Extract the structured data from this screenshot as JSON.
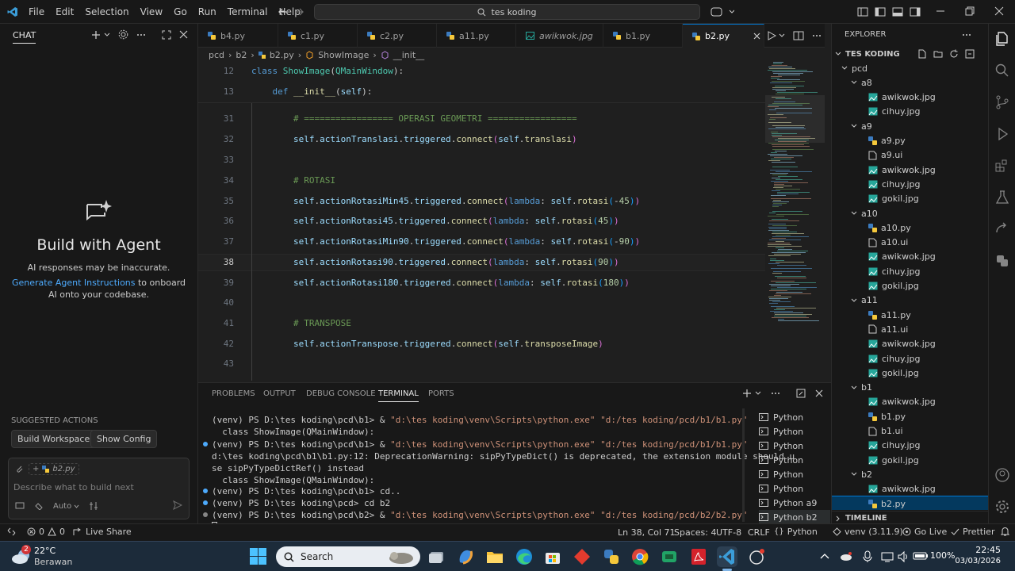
{
  "menu": [
    "File",
    "Edit",
    "Selection",
    "View",
    "Go",
    "Run",
    "Terminal",
    "Help"
  ],
  "search": {
    "text": "tes koding"
  },
  "chat": {
    "title": "CHAT",
    "headline": "Build with Agent",
    "disclaimer": "AI responses may be inaccurate.",
    "link": "Generate Agent Instructions",
    "link_rest": " to onboard AI onto your codebase.",
    "suggested_title": "SUGGESTED ACTIONS",
    "actions": [
      "Build Workspace",
      "Show Config"
    ],
    "attachment": "b2.py",
    "input_placeholder": "Describe what to build next",
    "mode": "Auto"
  },
  "tabs": [
    {
      "label": "b4.py",
      "icon": "python"
    },
    {
      "label": "c1.py",
      "icon": "python"
    },
    {
      "label": "c2.py",
      "icon": "python"
    },
    {
      "label": "a11.py",
      "icon": "python"
    },
    {
      "label": "awikwok.jpg",
      "icon": "image"
    },
    {
      "label": "b1.py",
      "icon": "python"
    },
    {
      "label": "b2.py",
      "icon": "python",
      "active": true
    }
  ],
  "breadcrumb": [
    "pcd",
    "b2",
    "b2.py",
    "ShowImage",
    "__init__"
  ],
  "code": {
    "sticky": [
      {
        "n": "12",
        "parts": [
          [
            "kw",
            "class "
          ],
          [
            "cls",
            "ShowImage"
          ],
          [
            "dt",
            "("
          ],
          [
            "cls",
            "QMainWindow"
          ],
          [
            "dt",
            "):"
          ]
        ]
      },
      {
        "n": "13",
        "parts": [
          [
            "dt",
            "    "
          ],
          [
            "kw",
            "def "
          ],
          [
            "fn",
            "__init__"
          ],
          [
            "dt",
            "("
          ],
          [
            "sf",
            "self"
          ],
          [
            "dt",
            "):"
          ]
        ]
      }
    ],
    "lines": [
      {
        "n": "30",
        "parts": []
      },
      {
        "n": "31",
        "parts": [
          [
            "dt",
            "        "
          ],
          [
            "cm",
            "# ================= OPERASI GEOMETRI ================="
          ]
        ]
      },
      {
        "n": "32",
        "parts": [
          [
            "dt",
            "        "
          ],
          [
            "sf",
            "self"
          ],
          [
            "dt",
            "."
          ],
          [
            "sf",
            "actionTranslasi"
          ],
          [
            "dt",
            "."
          ],
          [
            "sf",
            "triggered"
          ],
          [
            "dt",
            "."
          ],
          [
            "fn",
            "connect"
          ],
          [
            "pr",
            "("
          ],
          [
            "sf",
            "self"
          ],
          [
            "dt",
            "."
          ],
          [
            "fn",
            "translasi"
          ],
          [
            "pr",
            ")"
          ]
        ]
      },
      {
        "n": "33",
        "parts": []
      },
      {
        "n": "34",
        "parts": [
          [
            "dt",
            "        "
          ],
          [
            "cm",
            "# ROTASI"
          ]
        ]
      },
      {
        "n": "35",
        "parts": [
          [
            "dt",
            "        "
          ],
          [
            "sf",
            "self"
          ],
          [
            "dt",
            "."
          ],
          [
            "sf",
            "actionRotasiMin45"
          ],
          [
            "dt",
            "."
          ],
          [
            "sf",
            "triggered"
          ],
          [
            "dt",
            "."
          ],
          [
            "fn",
            "connect"
          ],
          [
            "pr",
            "("
          ],
          [
            "kw",
            "lambda"
          ],
          [
            "dt",
            ": "
          ],
          [
            "sf",
            "self"
          ],
          [
            "dt",
            "."
          ],
          [
            "fn",
            "rotasi"
          ],
          [
            "pb",
            "("
          ],
          [
            "dt",
            "-"
          ],
          [
            "nm",
            "45"
          ],
          [
            "pb",
            ")"
          ],
          [
            "pr",
            ")"
          ]
        ]
      },
      {
        "n": "36",
        "parts": [
          [
            "dt",
            "        "
          ],
          [
            "sf",
            "self"
          ],
          [
            "dt",
            "."
          ],
          [
            "sf",
            "actionRotasi45"
          ],
          [
            "dt",
            "."
          ],
          [
            "sf",
            "triggered"
          ],
          [
            "dt",
            "."
          ],
          [
            "fn",
            "connect"
          ],
          [
            "pr",
            "("
          ],
          [
            "kw",
            "lambda"
          ],
          [
            "dt",
            ": "
          ],
          [
            "sf",
            "self"
          ],
          [
            "dt",
            "."
          ],
          [
            "fn",
            "rotasi"
          ],
          [
            "pb",
            "("
          ],
          [
            "nm",
            "45"
          ],
          [
            "pb",
            ")"
          ],
          [
            "pr",
            ")"
          ]
        ]
      },
      {
        "n": "37",
        "parts": [
          [
            "dt",
            "        "
          ],
          [
            "sf",
            "self"
          ],
          [
            "dt",
            "."
          ],
          [
            "sf",
            "actionRotasiMin90"
          ],
          [
            "dt",
            "."
          ],
          [
            "sf",
            "triggered"
          ],
          [
            "dt",
            "."
          ],
          [
            "fn",
            "connect"
          ],
          [
            "pr",
            "("
          ],
          [
            "kw",
            "lambda"
          ],
          [
            "dt",
            ": "
          ],
          [
            "sf",
            "self"
          ],
          [
            "dt",
            "."
          ],
          [
            "fn",
            "rotasi"
          ],
          [
            "pb",
            "("
          ],
          [
            "dt",
            "-"
          ],
          [
            "nm",
            "90"
          ],
          [
            "pb",
            ")"
          ],
          [
            "pr",
            ")"
          ]
        ]
      },
      {
        "n": "38",
        "cur": true,
        "parts": [
          [
            "dt",
            "        "
          ],
          [
            "sf",
            "self"
          ],
          [
            "dt",
            "."
          ],
          [
            "sf",
            "actionRotasi90"
          ],
          [
            "dt",
            "."
          ],
          [
            "sf",
            "triggered"
          ],
          [
            "dt",
            "."
          ],
          [
            "fn",
            "connect"
          ],
          [
            "pr",
            "("
          ],
          [
            "kw",
            "lambda"
          ],
          [
            "dt",
            ": "
          ],
          [
            "sf",
            "self"
          ],
          [
            "dt",
            "."
          ],
          [
            "fn",
            "rotasi"
          ],
          [
            "pb",
            "("
          ],
          [
            "nm",
            "90"
          ],
          [
            "pb",
            ")"
          ],
          [
            "pr",
            ")"
          ]
        ]
      },
      {
        "n": "39",
        "parts": [
          [
            "dt",
            "        "
          ],
          [
            "sf",
            "self"
          ],
          [
            "dt",
            "."
          ],
          [
            "sf",
            "actionRotasi180"
          ],
          [
            "dt",
            "."
          ],
          [
            "sf",
            "triggered"
          ],
          [
            "dt",
            "."
          ],
          [
            "fn",
            "connect"
          ],
          [
            "pr",
            "("
          ],
          [
            "kw",
            "lambda"
          ],
          [
            "dt",
            ": "
          ],
          [
            "sf",
            "self"
          ],
          [
            "dt",
            "."
          ],
          [
            "fn",
            "rotasi"
          ],
          [
            "pb",
            "("
          ],
          [
            "nm",
            "180"
          ],
          [
            "pb",
            ")"
          ],
          [
            "pr",
            ")"
          ]
        ]
      },
      {
        "n": "40",
        "parts": []
      },
      {
        "n": "41",
        "parts": [
          [
            "dt",
            "        "
          ],
          [
            "cm",
            "# TRANSPOSE"
          ]
        ]
      },
      {
        "n": "42",
        "parts": [
          [
            "dt",
            "        "
          ],
          [
            "sf",
            "self"
          ],
          [
            "dt",
            "."
          ],
          [
            "sf",
            "actionTranspose"
          ],
          [
            "dt",
            "."
          ],
          [
            "sf",
            "triggered"
          ],
          [
            "dt",
            "."
          ],
          [
            "fn",
            "connect"
          ],
          [
            "pr",
            "("
          ],
          [
            "sf",
            "self"
          ],
          [
            "dt",
            "."
          ],
          [
            "fn",
            "transposeImage"
          ],
          [
            "pr",
            ")"
          ]
        ]
      },
      {
        "n": "43",
        "parts": []
      }
    ]
  },
  "panel": {
    "tabs": [
      "PROBLEMS",
      "OUTPUT",
      "DEBUG CONSOLE",
      "TERMINAL",
      "PORTS"
    ],
    "active": "TERMINAL",
    "terminal": [
      [
        [
          "dt",
          "(venv) PS D:\\tes koding\\pcd\\b1> & "
        ],
        [
          "ts",
          "\"d:\\tes koding\\venv\\Scripts\\python.exe\" \"d:/tes koding/pcd/b1/b1.py\""
        ]
      ],
      [
        [
          "dt",
          "  class ShowImage(QMainWindow):"
        ]
      ],
      [
        [
          "dt",
          "(venv) PS D:\\tes koding\\pcd\\b1> & "
        ],
        [
          "ts",
          "\"d:\\tes koding\\venv\\Scripts\\python.exe\" \"d:/tes koding/pcd/b1/b1.py\""
        ]
      ],
      [
        [
          "dt",
          "d:\\tes koding\\pcd\\b1\\b1.py:12: DeprecationWarning: sipPyTypeDict() is deprecated, the extension module should u"
        ]
      ],
      [
        [
          "dt",
          "se sipPyTypeDictRef() instead"
        ]
      ],
      [
        [
          "dt",
          "  class ShowImage(QMainWindow):"
        ]
      ],
      [
        [
          "dt",
          "(venv) PS D:\\tes koding\\pcd\\b1> cd.."
        ]
      ],
      [
        [
          "dt",
          "(venv) PS D:\\tes koding\\pcd> cd b2"
        ]
      ],
      [
        [
          "dt",
          "(venv) PS D:\\tes koding\\pcd\\b2> & "
        ],
        [
          "ts",
          "\"d:\\tes koding\\venv\\Scripts\\python.exe\" \"d:/tes koding/pcd/b2/b2.py\""
        ]
      ]
    ],
    "terminals": [
      "Python",
      "Python",
      "Python",
      "Python",
      "Python",
      "Python",
      "Python a9",
      "Python b2"
    ]
  },
  "explorer": {
    "title": "EXPLORER",
    "root": "TES KODING",
    "tree": [
      {
        "d": 0,
        "t": "folder",
        "label": "pcd"
      },
      {
        "d": 1,
        "t": "folder",
        "label": "a8"
      },
      {
        "d": 2,
        "t": "img",
        "label": "awikwok.jpg"
      },
      {
        "d": 2,
        "t": "img",
        "label": "cihuy.jpg"
      },
      {
        "d": 1,
        "t": "folder",
        "label": "a9"
      },
      {
        "d": 2,
        "t": "py",
        "label": "a9.py"
      },
      {
        "d": 2,
        "t": "ui",
        "label": "a9.ui"
      },
      {
        "d": 2,
        "t": "img",
        "label": "awikwok.jpg"
      },
      {
        "d": 2,
        "t": "img",
        "label": "cihuy.jpg"
      },
      {
        "d": 2,
        "t": "img",
        "label": "gokil.jpg"
      },
      {
        "d": 1,
        "t": "folder",
        "label": "a10"
      },
      {
        "d": 2,
        "t": "py",
        "label": "a10.py"
      },
      {
        "d": 2,
        "t": "ui",
        "label": "a10.ui"
      },
      {
        "d": 2,
        "t": "img",
        "label": "awikwok.jpg"
      },
      {
        "d": 2,
        "t": "img",
        "label": "cihuy.jpg"
      },
      {
        "d": 2,
        "t": "img",
        "label": "gokil.jpg"
      },
      {
        "d": 1,
        "t": "folder",
        "label": "a11"
      },
      {
        "d": 2,
        "t": "py",
        "label": "a11.py"
      },
      {
        "d": 2,
        "t": "ui",
        "label": "a11.ui"
      },
      {
        "d": 2,
        "t": "img",
        "label": "awikwok.jpg"
      },
      {
        "d": 2,
        "t": "img",
        "label": "cihuy.jpg"
      },
      {
        "d": 2,
        "t": "img",
        "label": "gokil.jpg"
      },
      {
        "d": 1,
        "t": "folder",
        "label": "b1"
      },
      {
        "d": 2,
        "t": "img",
        "label": "awikwok.jpg"
      },
      {
        "d": 2,
        "t": "py",
        "label": "b1.py"
      },
      {
        "d": 2,
        "t": "ui",
        "label": "b1.ui"
      },
      {
        "d": 2,
        "t": "img",
        "label": "cihuy.jpg"
      },
      {
        "d": 2,
        "t": "img",
        "label": "gokil.jpg"
      },
      {
        "d": 1,
        "t": "folder",
        "label": "b2"
      },
      {
        "d": 2,
        "t": "img",
        "label": "awikwok.jpg"
      },
      {
        "d": 2,
        "t": "py",
        "label": "b2.py",
        "sel": true
      }
    ],
    "timeline": "TIMELINE"
  },
  "status": {
    "errors": "0",
    "warnings": "0",
    "liveshare": "Live Share",
    "position": "Ln 38, Col 71",
    "spaces": "Spaces: 4",
    "encoding": "UTF-8",
    "eol": "CRLF",
    "language": "Python",
    "venv": "venv (3.11.9)",
    "golive": "Go Live",
    "prettier": "Prettier"
  },
  "taskbar": {
    "weather_temp": "22°C",
    "weather_desc": "Berawan",
    "weather_badge": "2",
    "search": "Search",
    "battery": "100%",
    "time": "22:45",
    "date": "03/03/2026"
  },
  "colors": {
    "accent": "#0078d4",
    "taskbar": "#1c2b3a"
  }
}
